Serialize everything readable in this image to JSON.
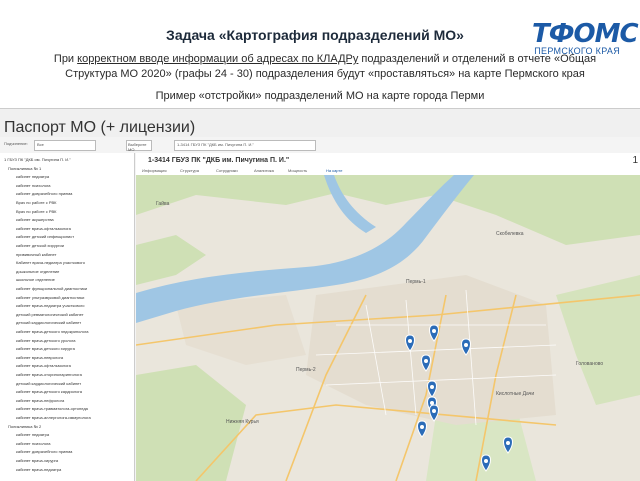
{
  "slide": {
    "title": "Задача «Картография подразделений МО»",
    "description_before": "При ",
    "description_link": "корректном вводе информации об адресах по КЛАДРу",
    "description_after": " подразделений и отделений в отчете «Общая Структура МО 2020» (графы 24 - 30) подразделения будут «проставляться» на карте Пермского края",
    "example": "Пример «отстройки» подразделений МО на карте города Перми"
  },
  "logo": {
    "mark": "ТФОМС",
    "sub": "ПЕРМСКОГО КРАЯ",
    "color": "#1c5aa6"
  },
  "app": {
    "header": "Паспорт МО (+ лицензии)",
    "toolbar": [
      "Подчинение:",
      "Все",
      "Выберите МО",
      "1-3414 ГБУЗ ПК \"ДКБ им. Пичугина П. И.\""
    ],
    "tree": [
      "1 ГБУЗ ПК \"ДКБ им. Пичугина П. И.\"",
      "Поликлиника № 1",
      "кабинет педиатра",
      "кабинет психолога",
      "кабинет доврачебного приема",
      "Врач по работе с РВК",
      "Врач по работе с РВК",
      "кабинет акушерства",
      "кабинет врача-офтальмолога",
      "кабинет детский инфекционист",
      "кабинет детской хирургии",
      "прививочный кабинет",
      "Кабинет врача-педиатра участкового",
      "дошкольное отделение",
      "школьное отделение",
      "кабинет функциональной диагностики",
      "кабинет ультразвуковой диагностики",
      "кабинет врача-педиатра участкового",
      "детский ревматологический кабинет",
      "детский кардиологический кабинет",
      "кабинет врача-детского эндокринолога",
      "кабинет врача-детского уролога",
      "кабинет врача детского хирурга",
      "кабинет врача-невролога",
      "кабинет врача-офтальмолога",
      "кабинет врача-оториноларинголога",
      "детский кардиологический кабинет",
      "кабинет врача-детского кардиолога",
      "кабинет врача-нефролога",
      "кабинет врача-травматолога-ортопеда",
      "кабинет врача-аллерголога-иммунолога",
      "Поликлиника № 2",
      "кабинет педиатра",
      "кабинет психолога",
      "кабинет доврачебного приема",
      "кабинет врача-хирурга",
      "кабинет врача-педиатра"
    ],
    "panel_title": "1-3414 ГБУЗ ПК \"ДКБ им. Пичугина П. И.\"",
    "panel_number": "1",
    "tabs": [
      "Информация",
      "Структура",
      "Сотрудники",
      "Аналитика",
      "Мощность",
      "На карте"
    ],
    "map_labels": [
      "Пермь-1",
      "Пермь-2",
      "Нижняя Курья",
      "Гайва",
      "Скобелевка",
      "Кислотные Дачи",
      "Голованово"
    ]
  }
}
